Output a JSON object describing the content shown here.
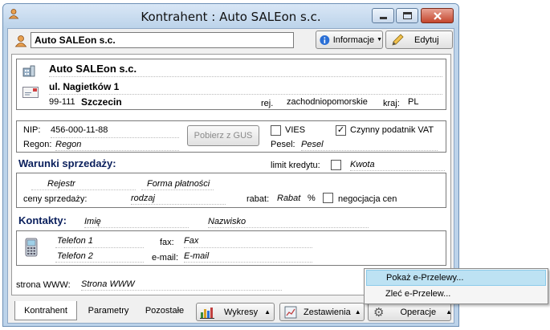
{
  "window": {
    "title": "Kontrahent : Auto SALEon s.c."
  },
  "toolbar": {
    "name": "Auto SALEon s.c.",
    "info_label": "Informacje",
    "edit_label": "Edytuj"
  },
  "address": {
    "name": "Auto SALEon s.c.",
    "street": "ul. Nagietków 1",
    "postal": "99-111",
    "city": "Szczecin",
    "region_label": "rej.",
    "region": "zachodniopomorskie",
    "country_label": "kraj:",
    "country": "PL"
  },
  "ids": {
    "nip_label": "NIP:",
    "nip": "456-000-11-88",
    "gus_button": "Pobierz z GUS",
    "vies_label": "VIES",
    "vat_label": "Czynny podatnik VAT",
    "regon_label": "Regon:",
    "regon": "Regon",
    "pesel_label": "Pesel:",
    "pesel": "Pesel"
  },
  "sales": {
    "header": "Warunki sprzedaży:",
    "credit_label": "limit kredytu:",
    "credit": "Kwota",
    "register": "Rejestr",
    "payment": "Forma płatności",
    "prices_label": "ceny sprzedaży:",
    "prices": "rodzaj",
    "discount_label": "rabat:",
    "discount": "Rabat",
    "percent": "%",
    "negotiation_label": "negocjacja cen"
  },
  "contacts": {
    "header": "Kontakty:",
    "first_name": "Imię",
    "last_name": "Nazwisko",
    "phone1": "Telefon 1",
    "phone2": "Telefon 2",
    "fax_label": "fax:",
    "fax": "Fax",
    "email_label": "e-mail:",
    "email": "E-mail"
  },
  "www": {
    "label": "strona WWW:",
    "value": "Strona WWW"
  },
  "tabs": {
    "t1": "Kontrahent",
    "t2": "Parametry",
    "t3": "Pozostałe"
  },
  "bottom": {
    "charts": "Wykresy",
    "reports": "Zestawienia",
    "operations": "Operacje"
  },
  "menu": {
    "item1": "Pokaż e-Przelewy...",
    "item2": "Zleć e-Przelew..."
  }
}
